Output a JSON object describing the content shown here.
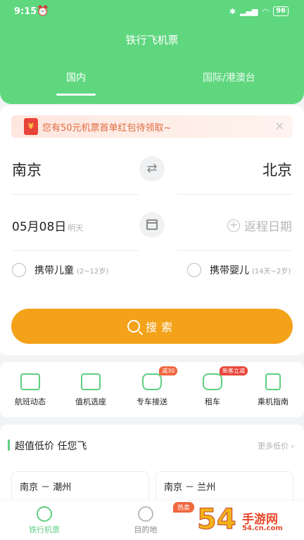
{
  "status_bar": {
    "time": "9:15",
    "battery": "96"
  },
  "header": {
    "title": "铁行飞机票"
  },
  "tabs": [
    {
      "label": "国内"
    },
    {
      "label": "国际/港澳台"
    }
  ],
  "promo": {
    "icon_text": "¥",
    "text": "您有50元机票首单红包待领取~"
  },
  "search_form": {
    "from_city": "南京",
    "to_city": "北京",
    "depart_date": "05月08日",
    "depart_day": "明天",
    "return_placeholder": "返程日期",
    "options": [
      {
        "label": "携带儿童",
        "age": "(2~12岁)"
      },
      {
        "label": "携带婴儿",
        "age": "(14天~2岁)"
      }
    ],
    "search_label": "搜索"
  },
  "services": [
    {
      "label": "航班动态",
      "icon": "monitor-icon"
    },
    {
      "label": "值机选座",
      "icon": "copy-icon"
    },
    {
      "label": "专车接送",
      "icon": "car-icon",
      "badge": "减30"
    },
    {
      "label": "租车",
      "icon": "rental-car-icon",
      "badge": "新客立减"
    },
    {
      "label": "乘机指南",
      "icon": "document-icon"
    }
  ],
  "deals": {
    "title": "超值低价 任您飞",
    "more": "更多低价",
    "routes": [
      {
        "label": "南京 － 潮州"
      },
      {
        "label": "南京 － 兰州"
      }
    ]
  },
  "bottom_nav": {
    "items": [
      {
        "label": "铁行机票"
      },
      {
        "label": "目的地"
      }
    ],
    "hot_badge": "热卖"
  },
  "watermark": {
    "big": "54",
    "small": "手游网",
    "url": "54.cn.com"
  }
}
